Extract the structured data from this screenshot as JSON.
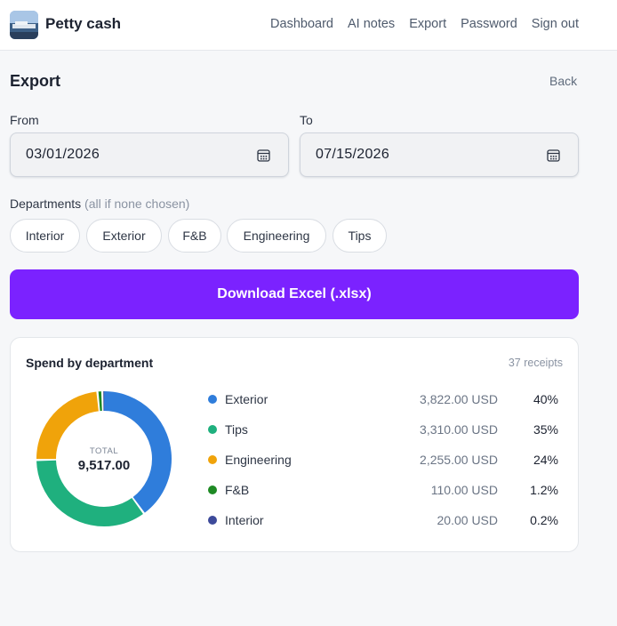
{
  "header": {
    "brand": "Petty cash",
    "nav": [
      "Dashboard",
      "AI notes",
      "Export",
      "Password",
      "Sign out"
    ]
  },
  "page": {
    "title": "Export",
    "back_label": "Back"
  },
  "filters": {
    "from_label": "From",
    "from_value": "03/01/2026",
    "to_label": "To",
    "to_value": "07/15/2026",
    "departments_label": "Departments",
    "departments_hint": "(all if none chosen)",
    "departments": [
      "Interior",
      "Exterior",
      "F&B",
      "Engineering",
      "Tips"
    ]
  },
  "download_label": "Download Excel (.xlsx)",
  "summary": {
    "title": "Spend by department",
    "receipts": "37 receipts",
    "total_label": "TOTAL",
    "total_value": "9,517.00",
    "items": [
      {
        "name": "Exterior",
        "amount": "3,822.00 USD",
        "pct": "40%",
        "color": "#2f7ddb"
      },
      {
        "name": "Tips",
        "amount": "3,310.00 USD",
        "pct": "35%",
        "color": "#1fb07e"
      },
      {
        "name": "Engineering",
        "amount": "2,255.00 USD",
        "pct": "24%",
        "color": "#f0a30a"
      },
      {
        "name": "F&B",
        "amount": "110.00 USD",
        "pct": "1.2%",
        "color": "#1e8a24"
      },
      {
        "name": "Interior",
        "amount": "20.00 USD",
        "pct": "0.2%",
        "color": "#3d4a9a"
      }
    ]
  },
  "chart_data": {
    "type": "pie",
    "categories": [
      "Exterior",
      "Tips",
      "Engineering",
      "F&B",
      "Interior"
    ],
    "values": [
      3822.0,
      3310.0,
      2255.0,
      110.0,
      20.0
    ],
    "title": "Spend by department",
    "colors": [
      "#2f7ddb",
      "#1fb07e",
      "#f0a30a",
      "#1e8a24",
      "#3d4a9a"
    ]
  }
}
